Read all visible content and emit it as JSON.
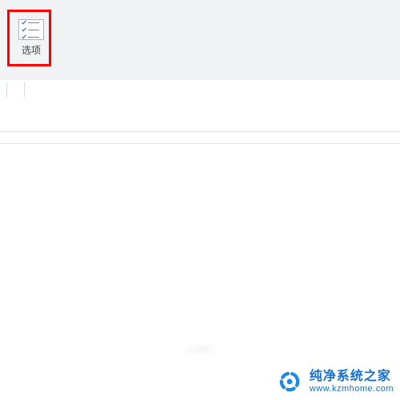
{
  "ribbon": {
    "options_label": "选项"
  },
  "watermark": {
    "title": "纯净系统之家",
    "url": "www.kzmhome.com"
  },
  "icons": {
    "options": "options-list-icon",
    "logo": "spinner-logo-icon"
  }
}
